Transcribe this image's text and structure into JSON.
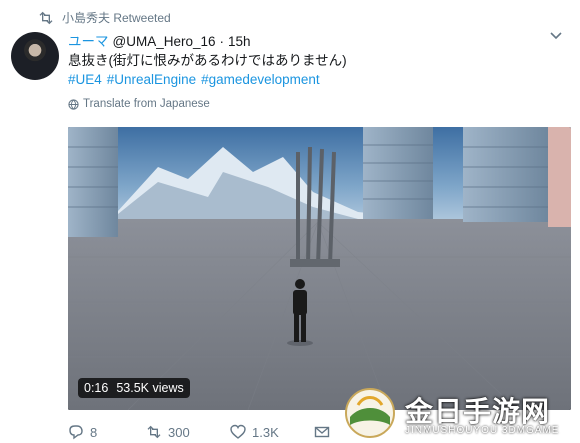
{
  "retweet": {
    "label": "小島秀夫 Retweeted"
  },
  "tweet": {
    "display_name": "ユーマ",
    "handle": "@UMA_Hero_16",
    "separator": "·",
    "time": "15h",
    "text": "息抜き(街灯に恨みがあるわけではありません)",
    "hashtags": [
      "#UE4",
      "#UnrealEngine",
      "#gamedevelopment"
    ],
    "translate_label": "Translate from Japanese"
  },
  "video": {
    "duration": "0:16",
    "views": "53.5K views"
  },
  "actions": {
    "replies": "8",
    "retweets": "300",
    "likes": "1.3K"
  },
  "watermark": {
    "title": "金日手游网",
    "subtitle": "JINMUSHOUYOU 3DMGAME"
  },
  "icons": {
    "retweet": "retweet-icon",
    "reply": "reply-icon",
    "like": "heart-icon",
    "dm": "envelope-icon",
    "globe": "globe-icon",
    "caret": "chevron-down-icon"
  },
  "colors": {
    "link": "#1b95e0",
    "muted": "#657786"
  }
}
